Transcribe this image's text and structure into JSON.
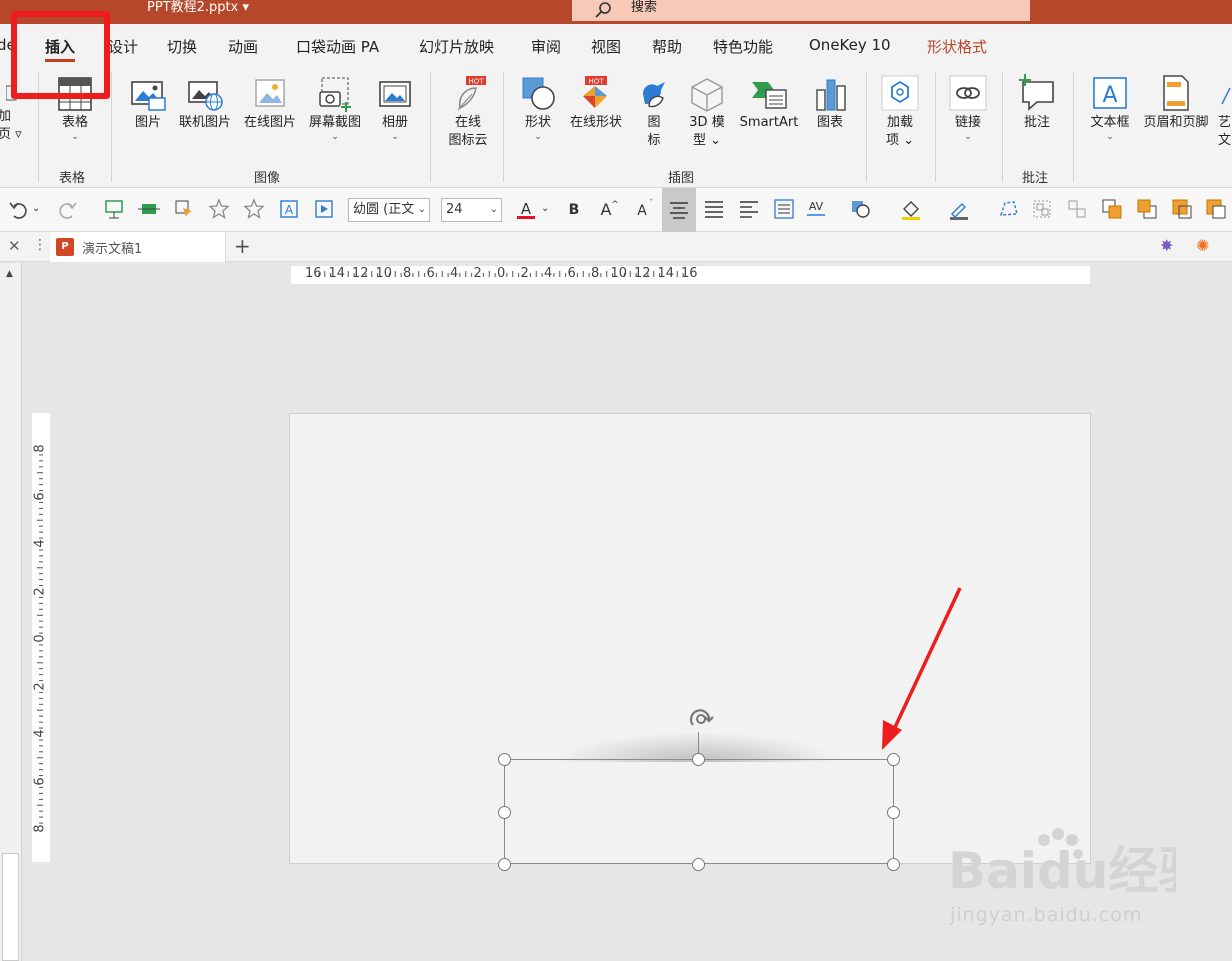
{
  "title_bar": {
    "filename": "PPT教程2.pptx",
    "search_label": "搜索"
  },
  "tabs": [
    {
      "label": "de",
      "state": "partial"
    },
    {
      "label": "插入",
      "state": "active"
    },
    {
      "label": "设计"
    },
    {
      "label": "切换"
    },
    {
      "label": "动画"
    },
    {
      "label": "口袋动画 PA"
    },
    {
      "label": "幻灯片放映"
    },
    {
      "label": "审阅"
    },
    {
      "label": "视图"
    },
    {
      "label": "帮助"
    },
    {
      "label": "特色功能"
    },
    {
      "label": "OneKey 10"
    },
    {
      "label": "形状格式",
      "color": "#b7472a"
    }
  ],
  "ribbon": {
    "addin_partial": {
      "line1": "加",
      "line2": "页 ▿"
    },
    "table": {
      "label": "表格",
      "group": "表格"
    },
    "images": {
      "group": "图像",
      "picture": "图片",
      "online_picture_linked": "联机图片",
      "online_picture": "在线图片",
      "screenshot": "屏幕截图",
      "album": "相册"
    },
    "iconcloud": {
      "line1": "在线",
      "line2": "图标云",
      "badge": "HOT"
    },
    "illustrations": {
      "group": "插图",
      "shapes": "形状",
      "online_shapes": "在线形状",
      "icons_l1": "图",
      "icons_l2": "标",
      "model3d_l1": "3D 模",
      "model3d_l2": "型",
      "smartart": "SmartArt",
      "chart": "图表",
      "badge": "HOT"
    },
    "addins": {
      "line1": "加载",
      "line2": "项"
    },
    "link": {
      "label": "链接"
    },
    "comments": {
      "label": "批注",
      "group": "批注"
    },
    "text": {
      "textbox": "文本框",
      "header_footer": "页眉和页脚",
      "partial1": "艺",
      "partial2": "文"
    }
  },
  "qat": {
    "font_name": "幼圆 (正文",
    "font_size": "24",
    "font_color": "#e81123"
  },
  "document_tab": {
    "name": "演示文稿1",
    "icon_label": "P"
  },
  "rulers": {
    "horizontal": [
      "16",
      "14",
      "12",
      "10",
      "8",
      "6",
      "4",
      "2",
      "0",
      "2",
      "4",
      "6",
      "8",
      "10",
      "12",
      "14",
      "16"
    ],
    "vertical": [
      "8",
      "6",
      "4",
      "2",
      "0",
      "2",
      "4",
      "6",
      "8"
    ]
  },
  "watermark": {
    "brand": "Baidu经验",
    "url": "jingyan.baidu.com"
  },
  "colors": {
    "accent": "#b7472a",
    "highlight": "#ee1c1c"
  }
}
